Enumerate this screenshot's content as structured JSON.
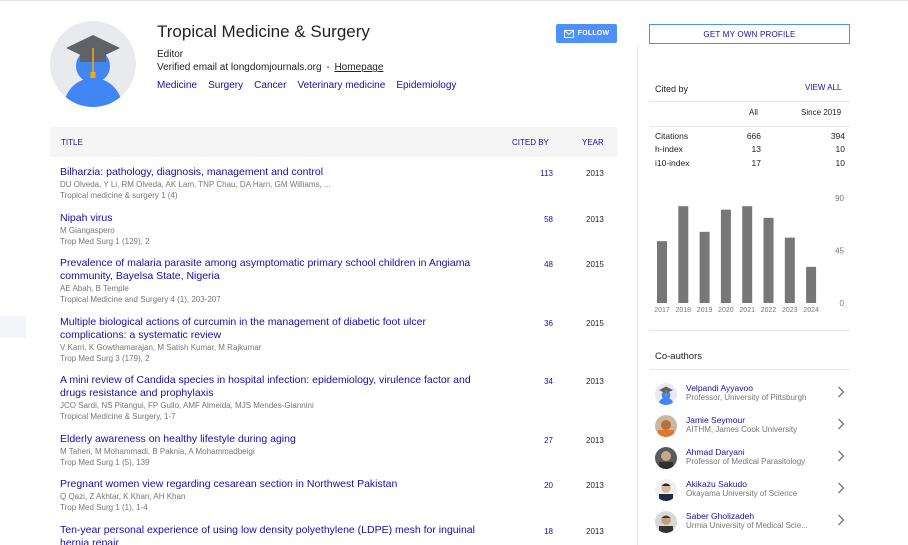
{
  "profile": {
    "name": "Tropical Medicine & Surgery",
    "role": "Editor",
    "email_text": "Verified email at longdomjournals.org",
    "separator": "-",
    "homepage_label": "Homepage",
    "interests": [
      "Medicine",
      "Surgery",
      "Cancer",
      "Veterinary medicine",
      "Epidemiology"
    ],
    "follow_label": "FOLLOW"
  },
  "table": {
    "headers": {
      "title": "TITLE",
      "cited_by": "CITED BY",
      "year": "YEAR"
    },
    "publications": [
      {
        "title": "Bilharzia: pathology, diagnosis, management and control",
        "authors": "DU Olveda, Y Li, RM Olveda, AK Lam, TNP Chau, DA Harn, GM Williams, ...",
        "venue": "Tropical medicine & surgery 1 (4)",
        "cited": "113",
        "year": "2013"
      },
      {
        "title": "Nipah virus",
        "authors": "M Giangaspero",
        "venue": "Trop Med Surg 1 (129), 2",
        "cited": "58",
        "year": "2013"
      },
      {
        "title": "Prevalence of malaria parasite among asymptomatic primary school children in Angiama community, Bayelsa State, Nigeria",
        "authors": "AE Abah, B Temple",
        "venue": "Tropical Medicine and Surgery 4 (1), 203-207",
        "cited": "48",
        "year": "2015"
      },
      {
        "title": "Multiple biological actions of curcumin in the management of diabetic foot ulcer complications: a systematic review",
        "authors": "V Karri, K Gowthamarajan, M Satish Kumar, M Rajkumar",
        "venue": "Trop Med Surg 3 (179), 2",
        "cited": "36",
        "year": "2015"
      },
      {
        "title": "A mini review of Candida species in hospital infection: epidemiology, virulence factor and drugs resistance and prophylaxis",
        "authors": "JCO Sardi, NS Pitangui, FP Gullo, AMF Almeida, MJS Mendes-Giannini",
        "venue": "Tropical Medicine & Surgery, 1-7",
        "cited": "34",
        "year": "2013"
      },
      {
        "title": "Elderly awareness on healthy lifestyle during aging",
        "authors": "M Taheri, M Mohammadi, B Paknia, A Mohammadbeigi",
        "venue": "Trop Med Surg 1 (5), 139",
        "cited": "27",
        "year": "2013"
      },
      {
        "title": "Pregnant women view regarding cesarean section in Northwest Pakistan",
        "authors": "Q Qazi, Z Akhtar, K Khan, AH Khan",
        "venue": "Trop Med Surg 1 (1), 1-4",
        "cited": "20",
        "year": "2013"
      },
      {
        "title": "Ten-year personal experience of using low density polyethylene (LDPE) mesh for inguinal hernia repair",
        "authors": "",
        "venue": "",
        "cited": "18",
        "year": "2013"
      }
    ]
  },
  "sidebar": {
    "profile_button": "GET MY OWN PROFILE",
    "cited_by_heading": "Cited by",
    "view_all": "VIEW ALL",
    "col_all": "All",
    "col_since": "Since 2019",
    "stats": [
      {
        "label": "Citations",
        "all": "666",
        "since": "394"
      },
      {
        "label": "h-index",
        "all": "13",
        "since": "10"
      },
      {
        "label": "i10-index",
        "all": "17",
        "since": "10"
      }
    ],
    "coauthors_heading": "Co-authors",
    "coauthors": [
      {
        "name": "Velpandi Ayyavoo",
        "affiliation": "Professor, University of Pittsburgh",
        "photo": "placeholder-avatar-icon"
      },
      {
        "name": "Jamie Seymour",
        "affiliation": "AITHM, James Cook University",
        "photo": "person-photo"
      },
      {
        "name": "Ahmad Daryani",
        "affiliation": "Professor of Medical Parasitology",
        "photo": "person-photo"
      },
      {
        "name": "Akikazu Sakudo",
        "affiliation": "Okayama University of Science",
        "photo": "person-photo"
      },
      {
        "name": "Saber Gholizadeh",
        "affiliation": "Urmia University of Medical Scie...",
        "photo": "person-photo"
      }
    ]
  },
  "chart_data": {
    "type": "bar",
    "categories": [
      "2017",
      "2018",
      "2019",
      "2020",
      "2021",
      "2022",
      "2023",
      "2024"
    ],
    "values": [
      53,
      83,
      61,
      80,
      83,
      73,
      56,
      31
    ],
    "ylim": [
      0,
      90
    ],
    "yticks": [
      0,
      45,
      90
    ],
    "grid": false,
    "bar_color": "#777777"
  },
  "colors": {
    "link": "#1a0dab",
    "follow_button": "#4d90fe",
    "muted_text": "#777777"
  }
}
